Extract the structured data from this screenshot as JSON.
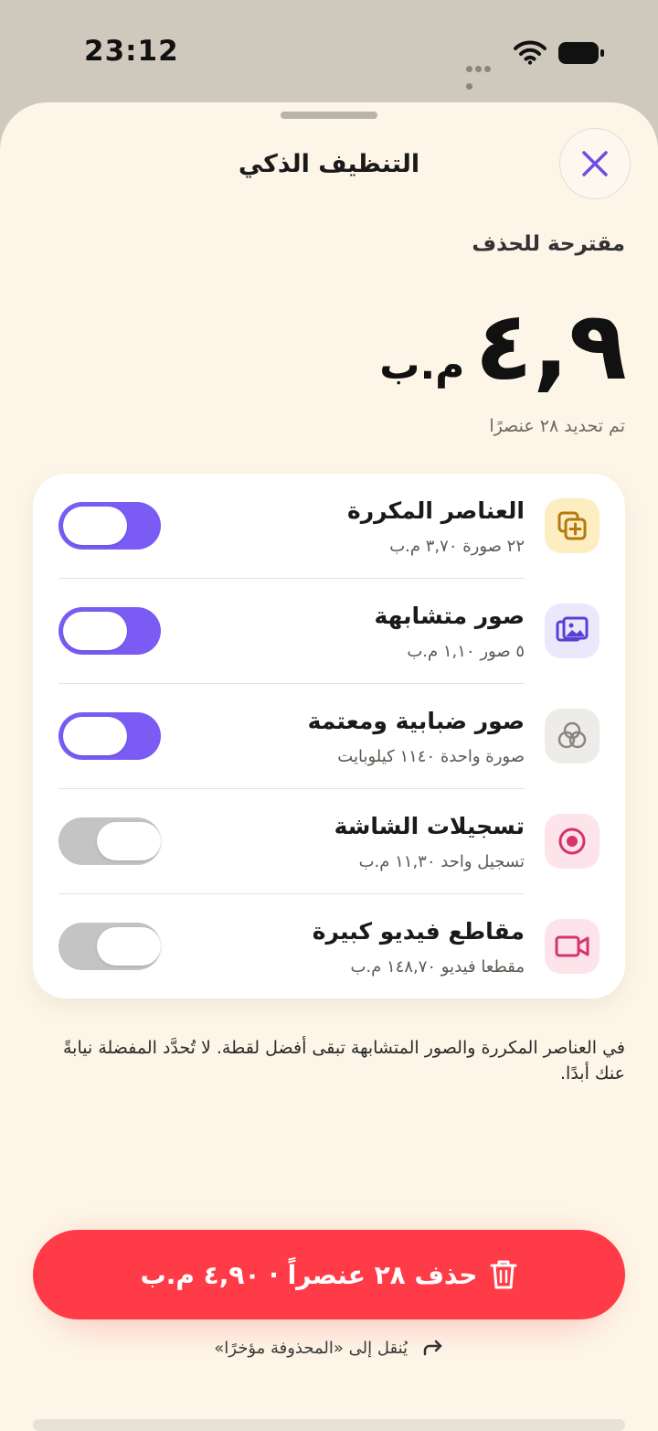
{
  "status_bar": {
    "time": "23:12"
  },
  "sheet": {
    "title": "التنظيف الذكي",
    "close_label": "×"
  },
  "summary": {
    "label": "مقترحة للحذف",
    "size_value": "٤,٩",
    "size_unit": "م.ب",
    "identified": "تم تحديد ٢٨ عنصرًا"
  },
  "categories": [
    {
      "title": "العناصر المكررة",
      "subtitle": "٢٢ صورة ٣,٧٠ م.ب",
      "icon": "duplicate-icon",
      "icon_bg": "#fdeec1",
      "icon_color": "#b37a10",
      "enabled": true
    },
    {
      "title": "صور متشابهة",
      "subtitle": "٥ صور ١,١٠ م.ب",
      "icon": "photos-icon",
      "icon_bg": "#ece8fb",
      "icon_color": "#5a3fd6",
      "enabled": true
    },
    {
      "title": "صور ضبابية ومعتمة",
      "subtitle": "صورة واحدة ١١٤٠ كيلوبايت",
      "icon": "blur-circles-icon",
      "icon_bg": "#eeece9",
      "icon_color": "#8a8680",
      "enabled": true
    },
    {
      "title": "تسجيلات الشاشة",
      "subtitle": "تسجيل واحد ١١,٣٠ م.ب",
      "icon": "record-icon",
      "icon_bg": "#fde4ea",
      "icon_color": "#d6336c",
      "enabled": false
    },
    {
      "title": "مقاطع فيديو كبيرة",
      "subtitle": "مقطعا فيديو ١٤٨,٧٠ م.ب",
      "icon": "video-icon",
      "icon_bg": "#fde4ea",
      "icon_color": "#d6336c",
      "enabled": false
    }
  ],
  "footnote": "في العناصر المكررة والصور المتشابهة تبقى أفضل لقطة. لا تُحدَّد المفضلة نيابةً عنك أبدًا.",
  "delete_button": {
    "label": "حذف ٢٨ عنصراً · ٤,٩٠ م.ب"
  },
  "moved_note": "يُنقل إلى «المحذوفة مؤخرًا»",
  "colors": {
    "accent": "#7a5cf5",
    "danger": "#ff3b47",
    "background": "#fdf6e8"
  }
}
